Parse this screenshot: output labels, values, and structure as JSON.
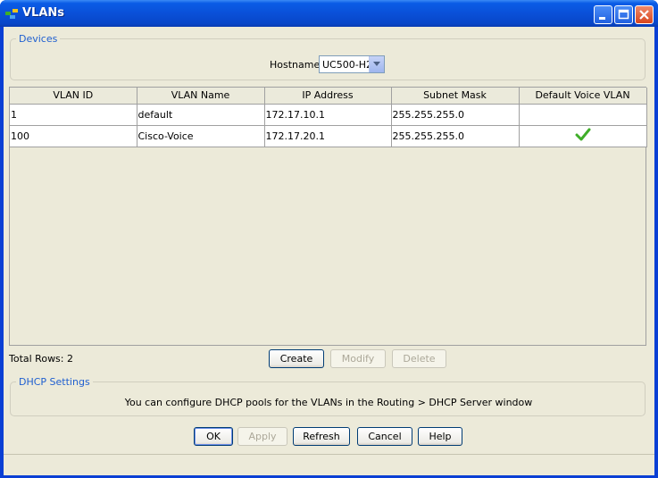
{
  "window": {
    "title": "VLANs",
    "icon": "network-icon",
    "controls": {
      "minimize": "minimize-icon",
      "maximize": "maximize-icon",
      "close": "close-icon"
    }
  },
  "devices": {
    "group_label": "Devices",
    "hostname_label": "Hostname:",
    "hostname_value": "UC500-H2"
  },
  "table": {
    "columns": [
      "VLAN ID",
      "VLAN Name",
      "IP Address",
      "Subnet Mask",
      "Default Voice VLAN"
    ],
    "rows": [
      {
        "vlan_id": "1",
        "vlan_name": "default",
        "ip": "172.17.10.1",
        "mask": "255.255.255.0",
        "voice": false
      },
      {
        "vlan_id": "100",
        "vlan_name": "Cisco-Voice",
        "ip": "172.17.20.1",
        "mask": "255.255.255.0",
        "voice": true
      }
    ]
  },
  "total_rows": "Total Rows: 2",
  "row_actions": {
    "create": "Create",
    "modify": "Modify",
    "delete": "Delete"
  },
  "dhcp": {
    "group_label": "DHCP Settings",
    "message": "You can configure DHCP pools for the VLANs in the Routing > DHCP Server window"
  },
  "dialog_buttons": {
    "ok": "OK",
    "apply": "Apply",
    "refresh": "Refresh",
    "cancel": "Cancel",
    "help": "Help"
  },
  "colors": {
    "title_bar": "#0a50d8",
    "group_label": "#1f5fd0",
    "check": "#3fae29",
    "panel": "#ecead9"
  }
}
